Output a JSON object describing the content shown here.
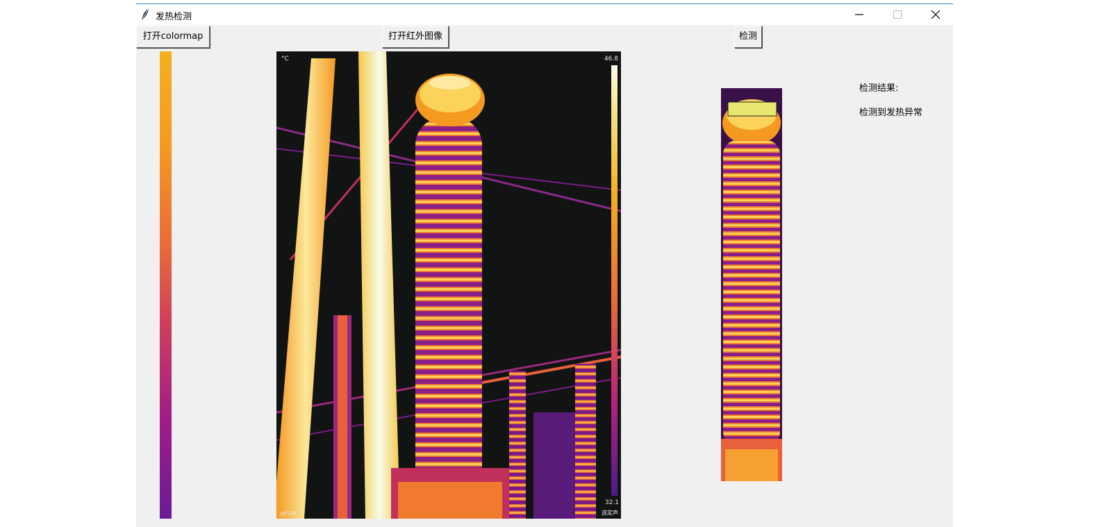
{
  "window": {
    "title": "发热检测",
    "icon": "feather-icon",
    "controls": [
      "minimize-icon",
      "maximize-icon",
      "close-icon"
    ]
  },
  "toolbar": {
    "open_colormap_label": "打开colormap",
    "open_infrared_label": "打开红外图像",
    "detect_label": "检测"
  },
  "infrared_image": {
    "unit": "°C",
    "max_temp": "46.8",
    "min_temp": "32.1",
    "brand": "◎FLIR",
    "signature": "选定声"
  },
  "result": {
    "label": "检测结果:",
    "text": "检测到发热异常"
  },
  "colors": {
    "window_bg": "#f0f0f0",
    "title_accent": "#3a7fcf",
    "ir_background": "#121414"
  }
}
